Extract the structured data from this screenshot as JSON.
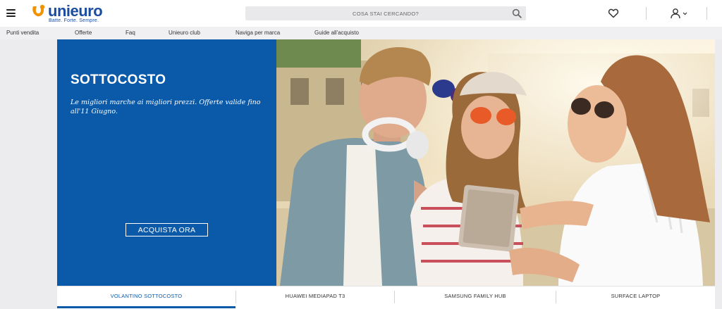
{
  "brand": {
    "name": "unieuro",
    "tagline": "Batte. Forte. Sempre.",
    "colors": {
      "blue": "#1a4ca0",
      "orange": "#f39200"
    }
  },
  "header": {
    "menu_icon": "hamburger-menu-icon",
    "search": {
      "placeholder": "COSA STAI CERCANDO?",
      "value": ""
    },
    "search_icon": "search-icon",
    "wishlist_icon": "heart-icon",
    "account_icon": "user-icon"
  },
  "nav": {
    "items": [
      "Punti vendita",
      "Offerte",
      "Faq",
      "Unieuro club",
      "Naviga per marca",
      "Guide all'acquisto"
    ]
  },
  "hero": {
    "title": "SOTTOCOSTO",
    "subtitle": "Le migliori marche ai migliori prezzi. Offerte valide fino all'11 Giugno.",
    "cta_label": "ACQUISTA ORA",
    "panel_color": "#0b5aaa"
  },
  "carousel": {
    "active_index": 0,
    "tabs": [
      "VOLANTINO SOTTOCOSTO",
      "HUAWEI MEDIAPAD T3",
      "SAMSUNG FAMILY HUB",
      "SURFACE LAPTOP"
    ]
  }
}
